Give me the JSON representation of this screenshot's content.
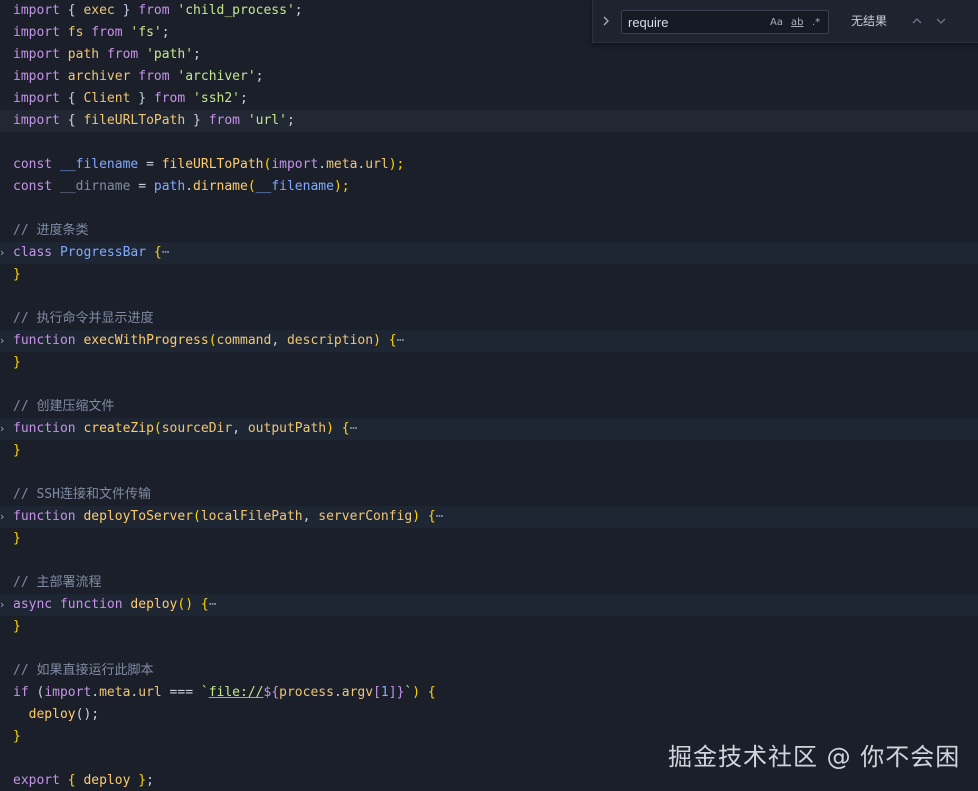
{
  "find_widget": {
    "query": "require",
    "option_match_case": "Aa",
    "option_whole_word": "ab",
    "option_regex": ".*",
    "result": "无结果"
  },
  "code": {
    "l1": {
      "a": "import",
      "b": " { ",
      "c": "exec",
      "d": " } ",
      "e": "from",
      "f": " ",
      "g": "'child_process'",
      "h": ";"
    },
    "l2": {
      "a": "import",
      "b": " ",
      "c": "fs",
      "d": " ",
      "e": "from",
      "f": " ",
      "g": "'fs'",
      "h": ";"
    },
    "l3": {
      "a": "import",
      "b": " ",
      "c": "path",
      "d": " ",
      "e": "from",
      "f": " ",
      "g": "'path'",
      "h": ";"
    },
    "l4": {
      "a": "import",
      "b": " ",
      "c": "archiver",
      "d": " ",
      "e": "from",
      "f": " ",
      "g": "'archiver'",
      "h": ";"
    },
    "l5": {
      "a": "import",
      "b": " { ",
      "c": "Client",
      "d": " } ",
      "e": "from",
      "f": " ",
      "g": "'ssh2'",
      "h": ";"
    },
    "l6": {
      "a": "import",
      "b": " { ",
      "c": "fileURLToPath",
      "d": " } ",
      "e": "from",
      "f": " ",
      "g": "'url'",
      "h": ";"
    },
    "l8": {
      "a": "const",
      "b": " ",
      "c": "__filename",
      "d": " = ",
      "e": "fileURLToPath",
      "f": "(",
      "g": "import",
      "h": ".",
      "i": "meta",
      "j": ".",
      "k": "url",
      "l": ");"
    },
    "l9": {
      "a": "const",
      "b": " ",
      "c": "__dirname",
      "d": " = ",
      "e": "path",
      "f": ".",
      "g": "dirname",
      "h": "(",
      "i": "__filename",
      "j": ");"
    },
    "l11": {
      "a": "// 进度条类"
    },
    "l12": {
      "a": "class",
      "b": " ",
      "c": "ProgressBar",
      "d": " ",
      "e": "{",
      "f": "⋯"
    },
    "l13": {
      "a": "}"
    },
    "l15": {
      "a": "// 执行命令并显示进度"
    },
    "l16": {
      "a": "function",
      "b": " ",
      "c": "execWithProgress",
      "d": "(",
      "e": "command",
      "f": ", ",
      "g": "description",
      "h": ")",
      "i": " ",
      "j": "{",
      "k": "⋯"
    },
    "l17": {
      "a": "}"
    },
    "l19": {
      "a": "// 创建压缩文件"
    },
    "l20": {
      "a": "function",
      "b": " ",
      "c": "createZip",
      "d": "(",
      "e": "sourceDir",
      "f": ", ",
      "g": "outputPath",
      "h": ")",
      "i": " ",
      "j": "{",
      "k": "⋯"
    },
    "l21": {
      "a": "}"
    },
    "l23": {
      "a": "// SSH连接和文件传输"
    },
    "l24": {
      "a": "function",
      "b": " ",
      "c": "deployToServer",
      "d": "(",
      "e": "localFilePath",
      "f": ", ",
      "g": "serverConfig",
      "h": ")",
      "i": " ",
      "j": "{",
      "k": "⋯"
    },
    "l25": {
      "a": "}"
    },
    "l27": {
      "a": "// 主部署流程"
    },
    "l28": {
      "a": "async",
      "b": " ",
      "c": "function",
      "d": " ",
      "e": "deploy",
      "f": "()",
      "g": " ",
      "h": "{",
      "i": "⋯"
    },
    "l29": {
      "a": "}"
    },
    "l31": {
      "a": "// 如果直接运行此脚本"
    },
    "l32": {
      "a": "if",
      "b": " (",
      "c": "import",
      "d": ".",
      "e": "meta",
      "f": ".",
      "g": "url",
      "h": " === ",
      "i": "`",
      "j": "file://",
      "k": "${",
      "l": "process",
      "m": ".",
      "n": "argv",
      "o": "[",
      "p": "1",
      "q": "]",
      "r": "}",
      "s": "`",
      "t": ")",
      "u": " ",
      "v": "{"
    },
    "l33": {
      "a": "  ",
      "b": "deploy",
      "c": "();"
    },
    "l34": {
      "a": "}"
    },
    "l36": {
      "a": "export",
      "b": " ",
      "c": "{",
      "d": " ",
      "e": "deploy",
      "f": " ",
      "g": "}",
      "h": ";"
    }
  },
  "fold_marker": ">",
  "watermark": "掘金技术社区 @ 你不会困"
}
